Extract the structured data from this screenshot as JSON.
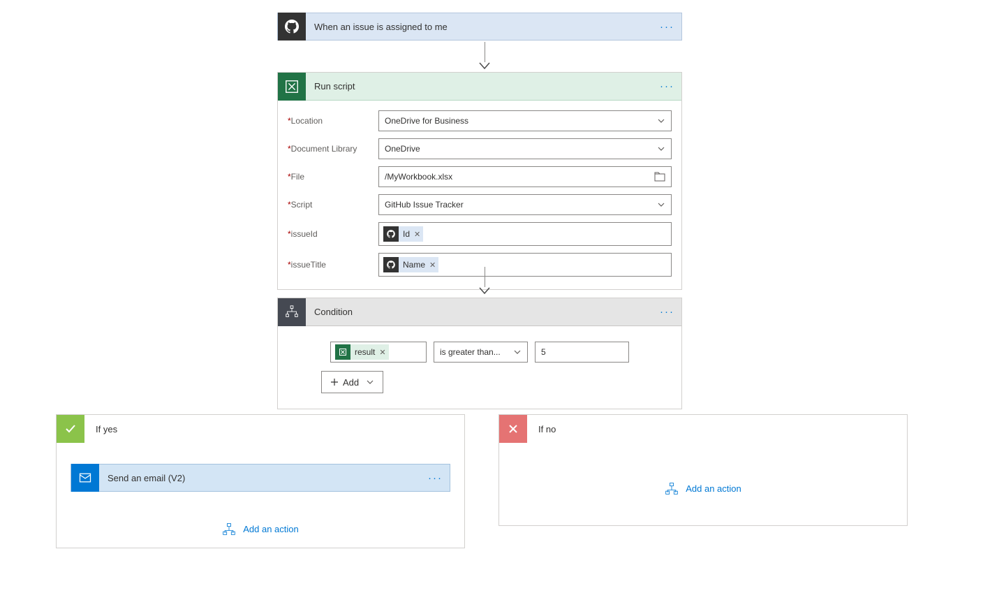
{
  "trigger": {
    "title": "When an issue is assigned to me"
  },
  "action1": {
    "title": "Run script",
    "fields": {
      "location": {
        "label": "Location",
        "value": "OneDrive for Business"
      },
      "docLibrary": {
        "label": "Document Library",
        "value": "OneDrive"
      },
      "file": {
        "label": "File",
        "value": "/MyWorkbook.xlsx"
      },
      "script": {
        "label": "Script",
        "value": "GitHub Issue Tracker"
      },
      "issueId": {
        "label": "issueId",
        "tokenLabel": "Id"
      },
      "issueTitle": {
        "label": "issueTitle",
        "tokenLabel": "Name"
      }
    }
  },
  "condition": {
    "title": "Condition",
    "leftToken": "result",
    "operator": "is greater than...",
    "rightValue": "5",
    "addLabel": "Add"
  },
  "yesBranch": {
    "title": "If yes",
    "action": {
      "title": "Send an email (V2)"
    },
    "addAction": "Add an action"
  },
  "noBranch": {
    "title": "If no",
    "addAction": "Add an action"
  }
}
